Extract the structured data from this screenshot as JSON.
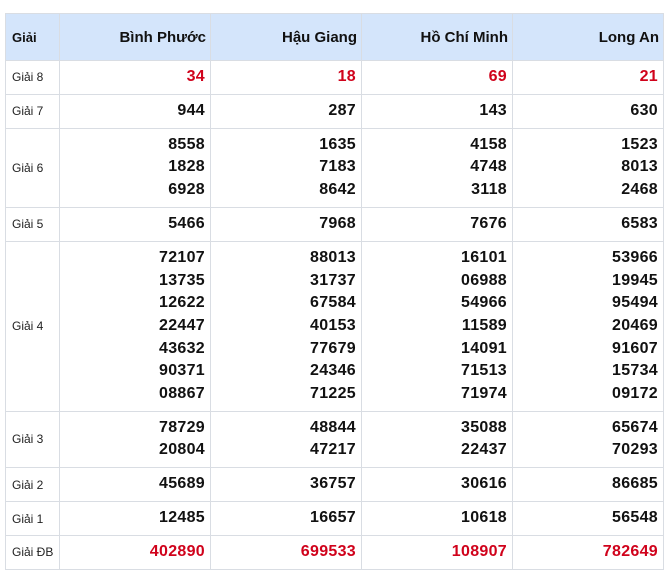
{
  "header": {
    "label": "Giải",
    "provinces": [
      "Bình Phước",
      "Hậu Giang",
      "Hồ Chí Minh",
      "Long An"
    ]
  },
  "accent_color": "#d0021b",
  "header_bg": "#d4e5fb",
  "rows": [
    {
      "label": "Giải 8",
      "values": [
        [
          "34"
        ],
        [
          "18"
        ],
        [
          "69"
        ],
        [
          "21"
        ]
      ]
    },
    {
      "label": "Giải 7",
      "values": [
        [
          "944"
        ],
        [
          "287"
        ],
        [
          "143"
        ],
        [
          "630"
        ]
      ]
    },
    {
      "label": "Giải 6",
      "values": [
        [
          "8558",
          "1828",
          "6928"
        ],
        [
          "1635",
          "7183",
          "8642"
        ],
        [
          "4158",
          "4748",
          "3118"
        ],
        [
          "1523",
          "8013",
          "2468"
        ]
      ]
    },
    {
      "label": "Giải 5",
      "values": [
        [
          "5466"
        ],
        [
          "7968"
        ],
        [
          "7676"
        ],
        [
          "6583"
        ]
      ]
    },
    {
      "label": "Giải 4",
      "values": [
        [
          "72107",
          "13735",
          "12622",
          "22447",
          "43632",
          "90371",
          "08867"
        ],
        [
          "88013",
          "31737",
          "67584",
          "40153",
          "77679",
          "24346",
          "71225"
        ],
        [
          "16101",
          "06988",
          "54966",
          "11589",
          "14091",
          "71513",
          "71974"
        ],
        [
          "53966",
          "19945",
          "95494",
          "20469",
          "91607",
          "15734",
          "09172"
        ]
      ]
    },
    {
      "label": "Giải 3",
      "values": [
        [
          "78729",
          "20804"
        ],
        [
          "48844",
          "47217"
        ],
        [
          "35088",
          "22437"
        ],
        [
          "65674",
          "70293"
        ]
      ]
    },
    {
      "label": "Giải 2",
      "values": [
        [
          "45689"
        ],
        [
          "36757"
        ],
        [
          "30616"
        ],
        [
          "86685"
        ]
      ]
    },
    {
      "label": "Giải 1",
      "values": [
        [
          "12485"
        ],
        [
          "16657"
        ],
        [
          "10618"
        ],
        [
          "56548"
        ]
      ]
    },
    {
      "label": "Giải ĐB",
      "values": [
        [
          "402890"
        ],
        [
          "699533"
        ],
        [
          "108907"
        ],
        [
          "782649"
        ]
      ]
    }
  ]
}
